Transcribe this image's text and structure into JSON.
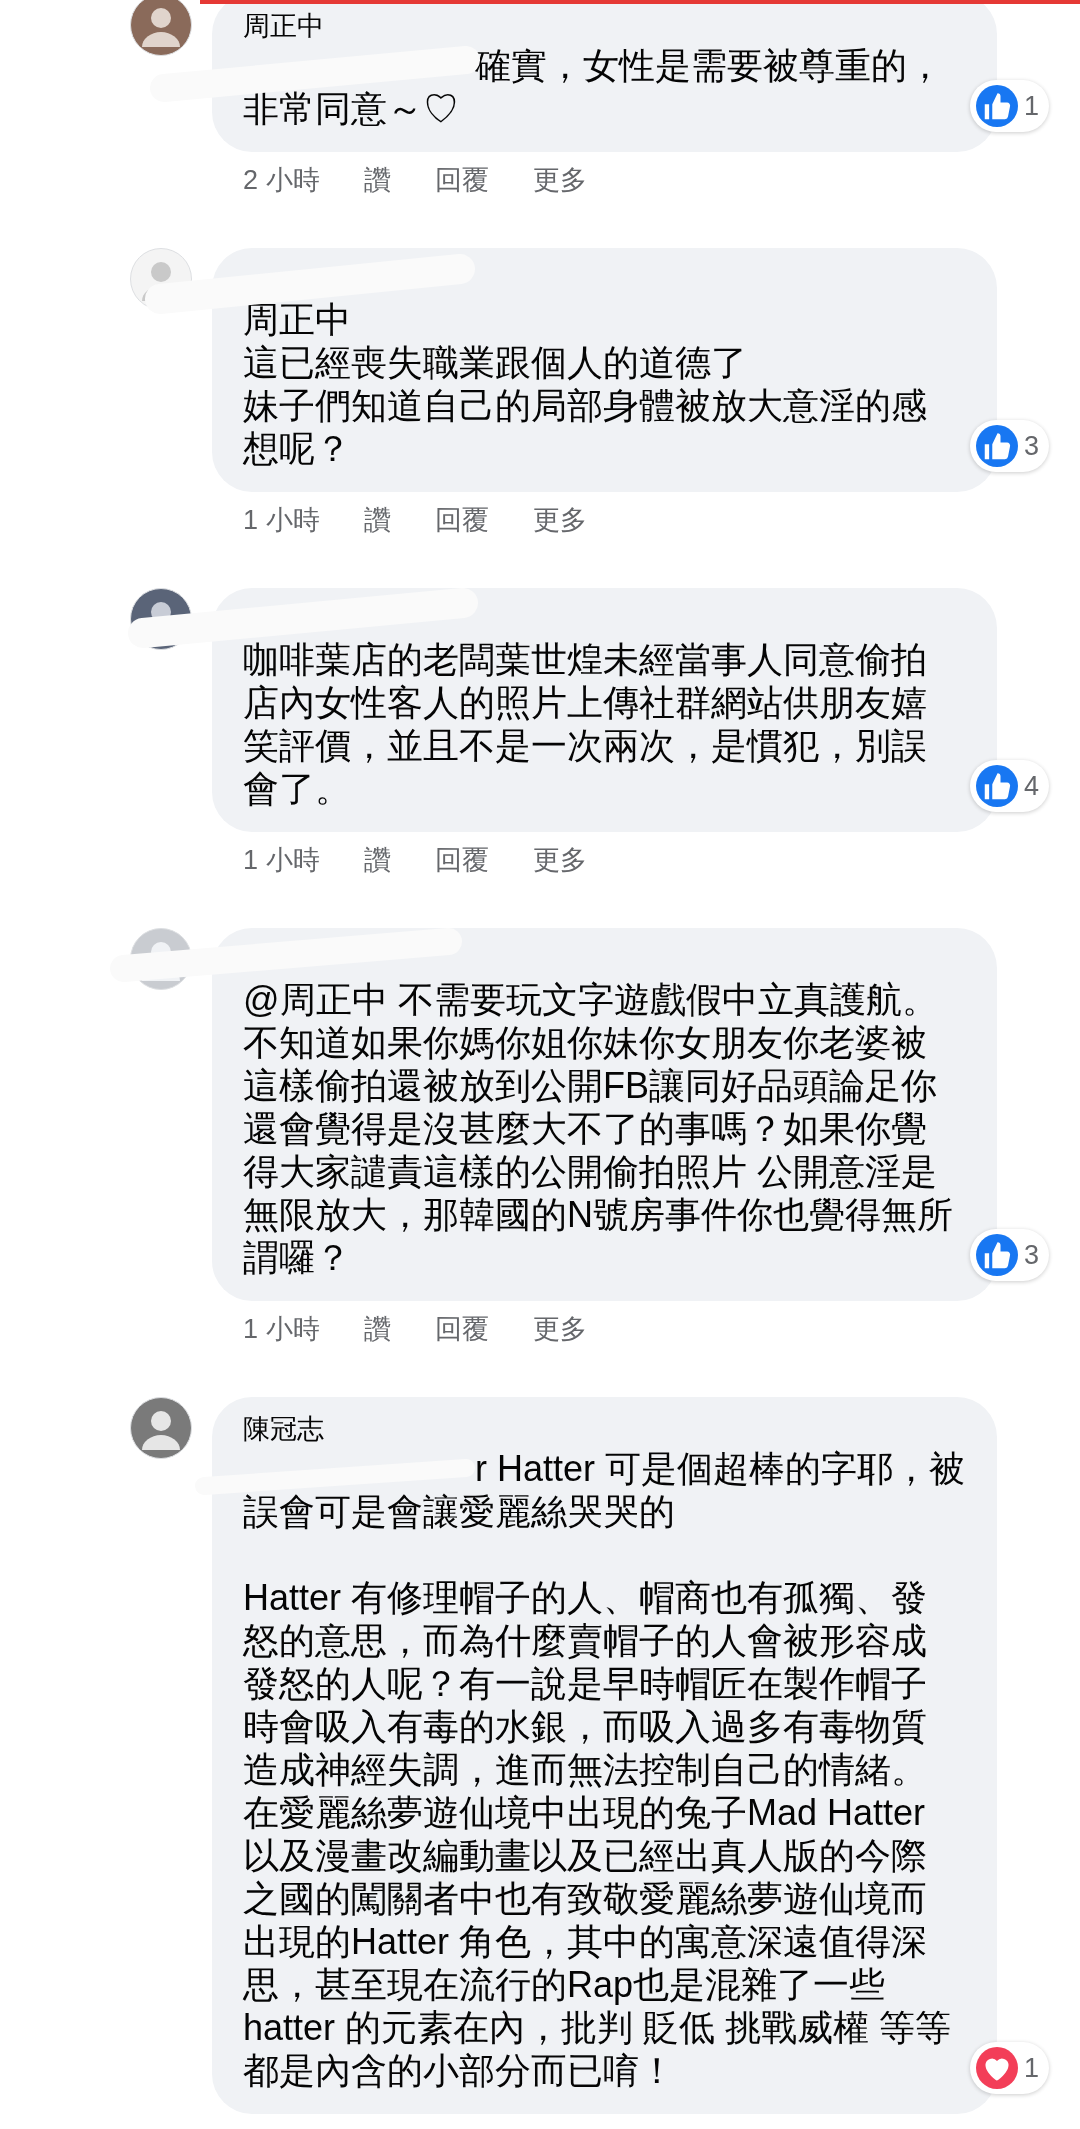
{
  "comments": [
    {
      "name": "周正中",
      "redacted": true,
      "paragraphs": [
        [
          "確實，女性是需要被尊重的，",
          "非常同意～♡"
        ]
      ],
      "reaction": {
        "kind": "like",
        "count": "1"
      },
      "meta": {
        "time": "2 小時",
        "actions": [
          "讚",
          "回覆",
          "更多"
        ]
      }
    },
    {
      "redacted": true,
      "paragraphs": [
        [
          "周正中",
          "這已經喪失職業跟個人的道德了",
          "妹子們知道自己的局部身體被放大意淫的感",
          "想呢？"
        ]
      ],
      "reaction": {
        "kind": "like",
        "count": "3"
      },
      "meta": {
        "time": "1 小時",
        "actions": [
          "讚",
          "回覆",
          "更多"
        ]
      }
    },
    {
      "redacted": true,
      "paragraphs": [
        [
          "咖啡葉店的老闆葉世煌未經當事人同意偷拍",
          "店內女性客人的照片上傳社群網站供朋友嬉",
          "笑評價，並且不是一次兩次，是慣犯，別誤",
          "會了。"
        ]
      ],
      "reaction": {
        "kind": "like",
        "count": "4"
      },
      "meta": {
        "time": "1 小時",
        "actions": [
          "讚",
          "回覆",
          "更多"
        ]
      }
    },
    {
      "redacted": true,
      "paragraphs": [
        [
          "@周正中 不需要玩文字遊戲假中立真護航。",
          "不知道如果你媽你姐你妹你女朋友你老婆被",
          "這樣偷拍還被放到公開FB讓同好品頭論足你",
          "還會覺得是沒甚麼大不了的事嗎？如果你覺",
          "得大家譴責這樣的公開偷拍照片 公開意淫是",
          "無限放大，那韓國的N號房事件你也覺得無所",
          "謂囉？"
        ]
      ],
      "reaction": {
        "kind": "like",
        "count": "3"
      },
      "meta": {
        "time": "1 小時",
        "actions": [
          "讚",
          "回覆",
          "更多"
        ]
      }
    },
    {
      "name": "陳冠志",
      "redacted": true,
      "paragraphs": [
        [
          "r Hatter 可是個超棒的字耶，被",
          "誤會可是會讓愛麗絲哭哭的"
        ],
        [
          "Hatter 有修理帽子的人、帽商也有孤獨、發",
          "怒的意思，而為什麼賣帽子的人會被形容成",
          "發怒的人呢？有一說是早時帽匠在製作帽子",
          "時會吸入有毒的水銀，而吸入過多有毒物質",
          "造成神經失調，進而無法控制自己的情緒。",
          "在愛麗絲夢遊仙境中出現的兔子Mad Hatter",
          "以及漫畫改編動畫以及已經出真人版的今際",
          "之國的闖關者中也有致敬愛麗絲夢遊仙境而",
          "出現的Hatter 角色，其中的寓意深遠值得深",
          "思，甚至現在流行的Rap也是混雜了一些",
          "hatter 的元素在內，批判 貶低 挑戰威權 等等",
          "都是內含的小部分而已唷！"
        ]
      ],
      "reaction": {
        "kind": "love",
        "count": "1"
      }
    }
  ]
}
